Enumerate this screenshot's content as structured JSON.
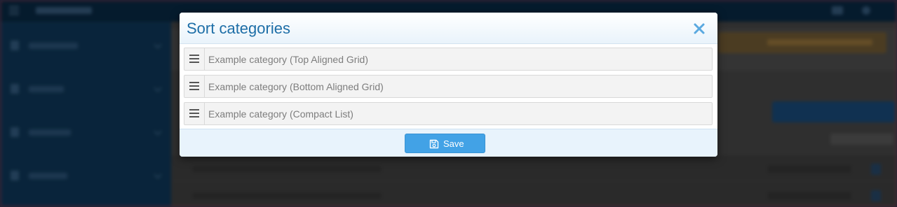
{
  "modal": {
    "title": "Sort categories",
    "close_icon": "close-icon",
    "categories": [
      {
        "label": "Example category (Top Aligned Grid)",
        "handle_icon": "drag-handle-icon"
      },
      {
        "label": "Example category (Bottom Aligned Grid)",
        "handle_icon": "drag-handle-icon"
      },
      {
        "label": "Example category (Compact List)",
        "handle_icon": "drag-handle-icon"
      }
    ],
    "save_label": "Save",
    "save_icon": "floppy-disk-icon"
  },
  "colors": {
    "title": "#1d6ea7",
    "close_icon": "#5aa9e0",
    "save_button": "#42a2e6",
    "footer_bg": "#e8f3fc"
  }
}
